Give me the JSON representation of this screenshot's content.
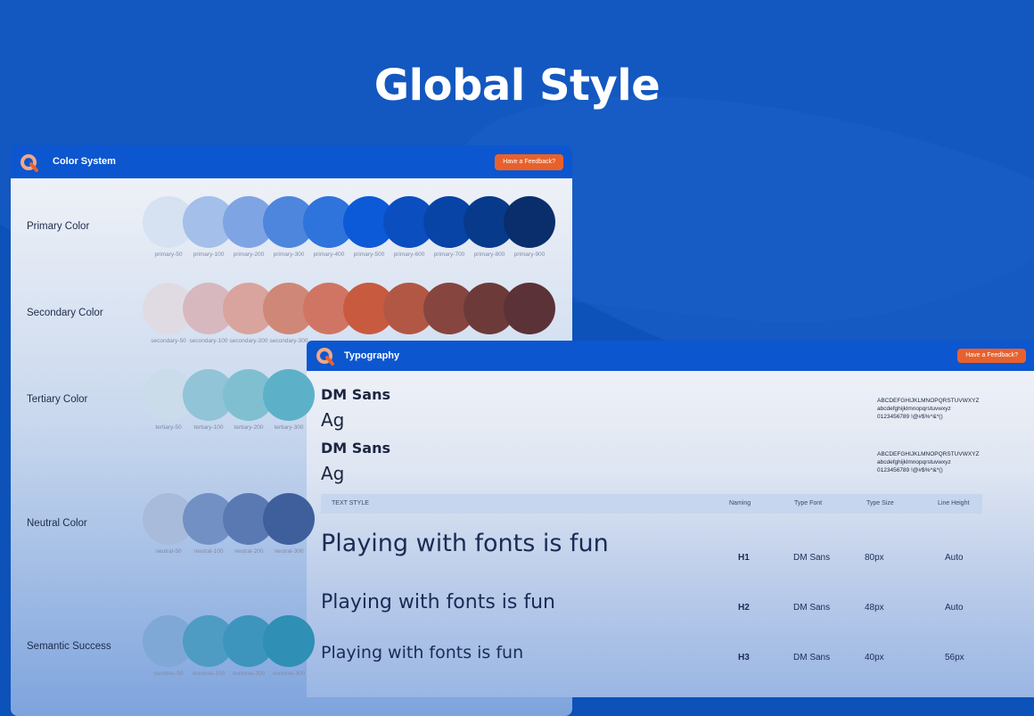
{
  "hero": {
    "title": "Global Style"
  },
  "colors": {
    "accent_button": "#e8612c",
    "header_blue": "#0c56d0"
  },
  "color_panel": {
    "title": "Color System",
    "feedback_button": "Have a Feedback?",
    "rows": [
      {
        "label": "Primary Color",
        "swatches": [
          "#d6e1f2",
          "#a3bfea",
          "#7fa4e4",
          "#4d86dc",
          "#2f73dc",
          "#0c5ad8",
          "#0a4ec0",
          "#0843a6",
          "#083a8c",
          "#0a2e6c"
        ],
        "names": [
          "primary-50",
          "primary-100",
          "primary-200",
          "primary-300",
          "primary-400",
          "primary-500",
          "primary-600",
          "primary-700",
          "primary-800",
          "primary-900"
        ]
      },
      {
        "label": "Secondary Color",
        "swatches": [
          "#e0dbe2",
          "#d8b8bf",
          "#d9a39e",
          "#cf8777",
          "#d07563",
          "#c85a3f",
          "#b25743",
          "#86453f",
          "#6d3a3a",
          "#5a3238"
        ],
        "names": [
          "secondary-50",
          "secondary-100",
          "secondary-200",
          "secondary-300",
          "",
          "",
          "",
          "",
          "",
          ""
        ]
      },
      {
        "label": "Tertiary Color",
        "swatches": [
          "#cadbea",
          "#90c4d6",
          "#7fbfd0",
          "#5cb1c8"
        ],
        "names": [
          "tertiary-50",
          "tertiary-100",
          "tertiary-200",
          "tertiary-300"
        ]
      },
      {
        "label": "Neutral Color",
        "swatches": [
          "#a9bbdb",
          "#7390c4",
          "#5a79b3",
          "#3f5f9c"
        ],
        "names": [
          "neutral-50",
          "neutral-100",
          "neutral-200",
          "neutral-300"
        ]
      },
      {
        "label": "Semantic Success",
        "swatches": [
          "#7fa8d6",
          "#4e9cc4",
          "#3d95bd",
          "#2f8fb4"
        ],
        "names": [
          "success-50",
          "success-100",
          "success-200",
          "success-300"
        ]
      }
    ]
  },
  "type_panel": {
    "title": "Typography",
    "feedback_button": "Have a Feedback?",
    "fonts": [
      {
        "name": "DM Sans",
        "sample": "Ag",
        "charset": [
          "ABCDEFGHIJKLMNOPQRSTUVWXYZ",
          "abcdefghijklmnopqrstuvwxyz",
          "0123456789 !@#$%^&*()"
        ]
      },
      {
        "name": "DM Sans",
        "sample": "Ag",
        "charset": [
          "ABCDEFGHIJKLMNOPQRSTUVWXYZ",
          "abcdefghijklmnopqrstuvwxyz",
          "0123456789 !@#$%^&*()"
        ]
      }
    ],
    "table": {
      "headers": [
        "TEXT STYLE",
        "Naming",
        "Type Font",
        "Type Size",
        "Line Height"
      ],
      "rows": [
        {
          "sample": "Playing with fonts is fun",
          "naming": "H1",
          "font": "DM Sans",
          "size": "80px",
          "line_height": "Auto"
        },
        {
          "sample": "Playing with fonts is fun",
          "naming": "H2",
          "font": "DM Sans",
          "size": "48px",
          "line_height": "Auto"
        },
        {
          "sample": "Playing with fonts is fun",
          "naming": "H3",
          "font": "DM Sans",
          "size": "40px",
          "line_height": "56px"
        }
      ]
    }
  }
}
